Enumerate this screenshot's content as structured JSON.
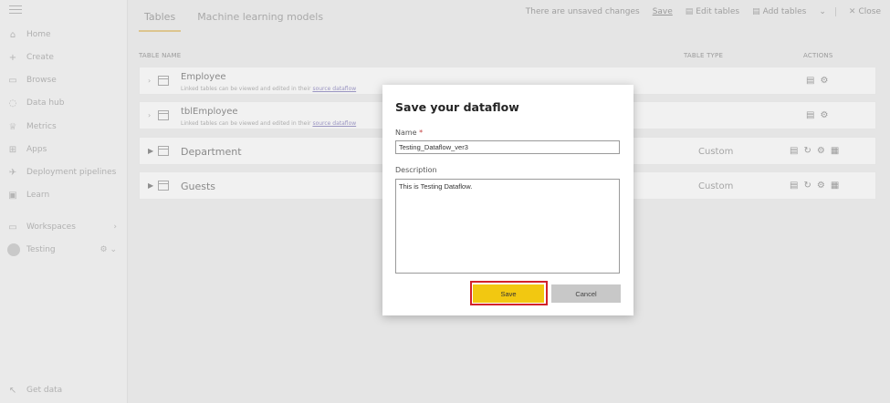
{
  "sidebar": {
    "items": [
      {
        "label": "Home",
        "icon": "home-icon",
        "glyph": "⌂"
      },
      {
        "label": "Create",
        "icon": "plus-icon",
        "glyph": "+"
      },
      {
        "label": "Browse",
        "icon": "folder-icon",
        "glyph": "▭"
      },
      {
        "label": "Data hub",
        "icon": "cylinder-icon",
        "glyph": "◌"
      },
      {
        "label": "Metrics",
        "icon": "trophy-icon",
        "glyph": "♕"
      },
      {
        "label": "Apps",
        "icon": "apps-icon",
        "glyph": "⊞"
      },
      {
        "label": "Deployment pipelines",
        "icon": "rocket-icon",
        "glyph": "✈"
      },
      {
        "label": "Learn",
        "icon": "book-icon",
        "glyph": "▣"
      }
    ],
    "workspaces_label": "Workspaces",
    "workspace_name": "Testing",
    "get_data_label": "Get data"
  },
  "tabs": [
    {
      "label": "Tables",
      "active": true
    },
    {
      "label": "Machine learning models",
      "active": false
    }
  ],
  "toolbar": {
    "status": "There are unsaved changes",
    "save": "Save",
    "edit_tables": "Edit tables",
    "add_tables": "Add tables",
    "close": "Close"
  },
  "columns": {
    "name": "TABLE NAME",
    "type": "TABLE TYPE",
    "actions": "ACTIONS"
  },
  "rows": [
    {
      "name": "Employee",
      "sub_text": "Linked tables can be viewed and edited in their",
      "sub_link": "source dataflow",
      "type": ""
    },
    {
      "name": "tblEmployee",
      "sub_text": "Linked tables can be viewed and edited in their",
      "sub_link": "source dataflow",
      "type": ""
    },
    {
      "name": "Department",
      "sub_text": "",
      "sub_link": "",
      "type": "Custom"
    },
    {
      "name": "Guests",
      "sub_text": "",
      "sub_link": "",
      "type": "Custom"
    }
  ],
  "dialog": {
    "title": "Save your dataflow",
    "name_label": "Name",
    "required_mark": "*",
    "name_value": "Testing_Dataflow_ver3",
    "description_label": "Description",
    "description_value": "This is Testing Dataflow.",
    "save_label": "Save",
    "cancel_label": "Cancel"
  },
  "colors": {
    "accent": "#f2c811",
    "highlight": "#d3222a"
  }
}
